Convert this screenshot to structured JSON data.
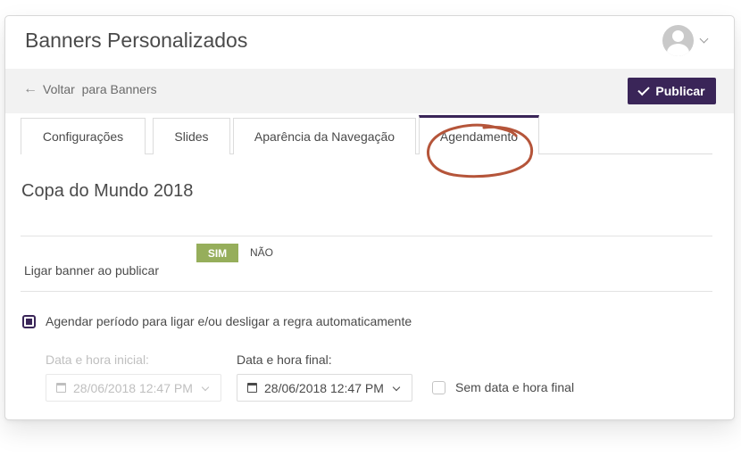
{
  "header": {
    "title": "Banners Personalizados"
  },
  "toolbar": {
    "back_label": "Voltar  para Banners",
    "publish_label": "Publicar"
  },
  "tabs": [
    {
      "label": "Configurações",
      "active": false
    },
    {
      "label": "Slides",
      "active": false
    },
    {
      "label": "Aparência da Navegação",
      "active": false
    },
    {
      "label": "Agendamento",
      "active": true
    }
  ],
  "section": {
    "title": "Copa do Mundo 2018"
  },
  "publish_toggle": {
    "label": "Ligar banner ao publicar",
    "on_label": "SIM",
    "off_label": "NÃO",
    "value": "SIM"
  },
  "schedule": {
    "checkbox_label": "Agendar período para ligar e/ou desligar a regra automaticamente",
    "checked": true,
    "start": {
      "label": "Data e hora inicial:",
      "value": "28/06/2018 12:47 PM",
      "disabled": true
    },
    "end": {
      "label": "Data e hora final:",
      "value": "28/06/2018 12:47 PM",
      "disabled": false
    },
    "no_end_label": "Sem data e hora final",
    "no_end_checked": false
  },
  "colors": {
    "accent": "#3a2558",
    "toggle_on": "#96ae5b",
    "annotation": "#b5553a"
  }
}
